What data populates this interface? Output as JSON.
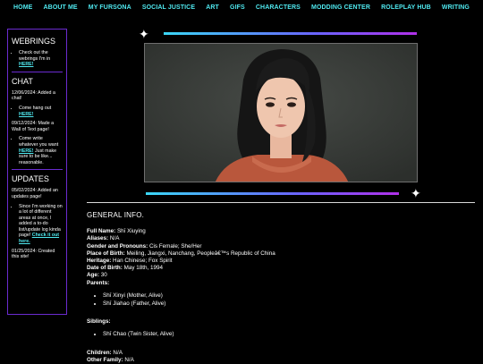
{
  "nav": {
    "items": [
      "HOME",
      "ABOUT ME",
      "MY FURSONA",
      "SOCIAL JUSTICE",
      "ART",
      "GIFS",
      "CHARACTERS",
      "MODDING CENTER",
      "ROLEPLAY HUB",
      "WRITING"
    ]
  },
  "sidebar": {
    "webrings": {
      "heading": "WEBRINGS",
      "item_text": "Check out the webrings I'm in",
      "item_link": "HERE!"
    },
    "chat": {
      "heading": "CHAT",
      "date1": "12/06/2024: Added a chat!",
      "item1_text": "Come hang out",
      "item1_link": "HERE!",
      "date2": "09/12/2024: Made a Wall of Text page!",
      "item2_text": "Come write whatever you want",
      "item2_link": "HERE!",
      "item2_tail": "Just make sure to be like... reasonable."
    },
    "updates": {
      "heading": "UPDATES",
      "date1": "05/02/2024: Added an updates page!",
      "item1_text": "Since I'm working on a lot of different areas at once, I added a to-do list/update log kinda page!",
      "item1_link": "Check it out here.",
      "date2": "01/25/2024: Created this site!"
    }
  },
  "info": {
    "heading": "GENERAL INFO.",
    "rows": [
      {
        "label": "Full Name:",
        "value": "Shī Xiuying"
      },
      {
        "label": "Aliases:",
        "value": "N/A"
      },
      {
        "label": "Gender and Pronouns:",
        "value": "Cis Female; She/Her"
      },
      {
        "label": "Place of Birth:",
        "value": "Meiling, Jiangxi, Nanchang, Peopleâ€™s Republic of China"
      },
      {
        "label": "Heritage:",
        "value": "Han Chinese; Fox Spirit"
      },
      {
        "label": "Date of Birth:",
        "value": "May 18th, 1994"
      },
      {
        "label": "Age:",
        "value": "30"
      },
      {
        "label": "Parents:",
        "value": ""
      }
    ],
    "parents": [
      "Shī Xinyi (Mother, Alive)",
      "Shī Jiahao (Father, Alive)"
    ],
    "siblings_label": "Siblings:",
    "siblings": [
      "Shī Chao (Twin Sister, Alive)"
    ],
    "children_label": "Children:",
    "children_value": "N/A",
    "other_family_label": "Other Family:",
    "other_family_value": "N/A"
  },
  "colors": {
    "nav": "#4fe8ef",
    "border": "#6a2bd0",
    "gradient_start": "#3ad6f5",
    "gradient_end": "#b030e8"
  }
}
